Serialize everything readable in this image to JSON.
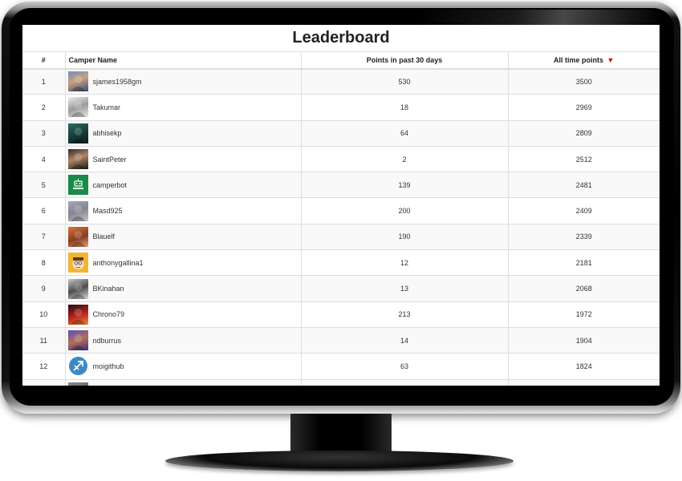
{
  "title": "Leaderboard",
  "columns": {
    "rank": "#",
    "name": "Camper Name",
    "recent": "Points in past 30 days",
    "alltime": "All time points",
    "sort_icon": "▼"
  },
  "colors": {
    "sort_arrow": "#e00000"
  },
  "rows": [
    {
      "rank": "1",
      "name": "sjames1958gm",
      "recent": "530",
      "alltime": "3500",
      "avatar": "avatar-photo-icon"
    },
    {
      "rank": "2",
      "name": "Takumar",
      "recent": "18",
      "alltime": "2969",
      "avatar": "avatar-photo-icon"
    },
    {
      "rank": "3",
      "name": "abhisekp",
      "recent": "64",
      "alltime": "2809",
      "avatar": "avatar-photo-icon"
    },
    {
      "rank": "4",
      "name": "SaintPeter",
      "recent": "2",
      "alltime": "2512",
      "avatar": "avatar-photo-icon"
    },
    {
      "rank": "5",
      "name": "camperbot",
      "recent": "139",
      "alltime": "2481",
      "avatar": "camperbot-icon"
    },
    {
      "rank": "6",
      "name": "Masd925",
      "recent": "200",
      "alltime": "2409",
      "avatar": "avatar-photo-icon"
    },
    {
      "rank": "7",
      "name": "Blauelf",
      "recent": "190",
      "alltime": "2339",
      "avatar": "avatar-photo-icon"
    },
    {
      "rank": "8",
      "name": "anthonygallina1",
      "recent": "12",
      "alltime": "2181",
      "avatar": "avatar-cartoon-icon"
    },
    {
      "rank": "9",
      "name": "BKinahan",
      "recent": "13",
      "alltime": "2068",
      "avatar": "avatar-photo-icon"
    },
    {
      "rank": "10",
      "name": "Chrono79",
      "recent": "213",
      "alltime": "1972",
      "avatar": "avatar-cartoon-icon"
    },
    {
      "rank": "11",
      "name": "ndburrus",
      "recent": "14",
      "alltime": "1904",
      "avatar": "avatar-photo-icon"
    },
    {
      "rank": "12",
      "name": "moigithub",
      "recent": "63",
      "alltime": "1824",
      "avatar": "sagittarius-icon"
    }
  ]
}
